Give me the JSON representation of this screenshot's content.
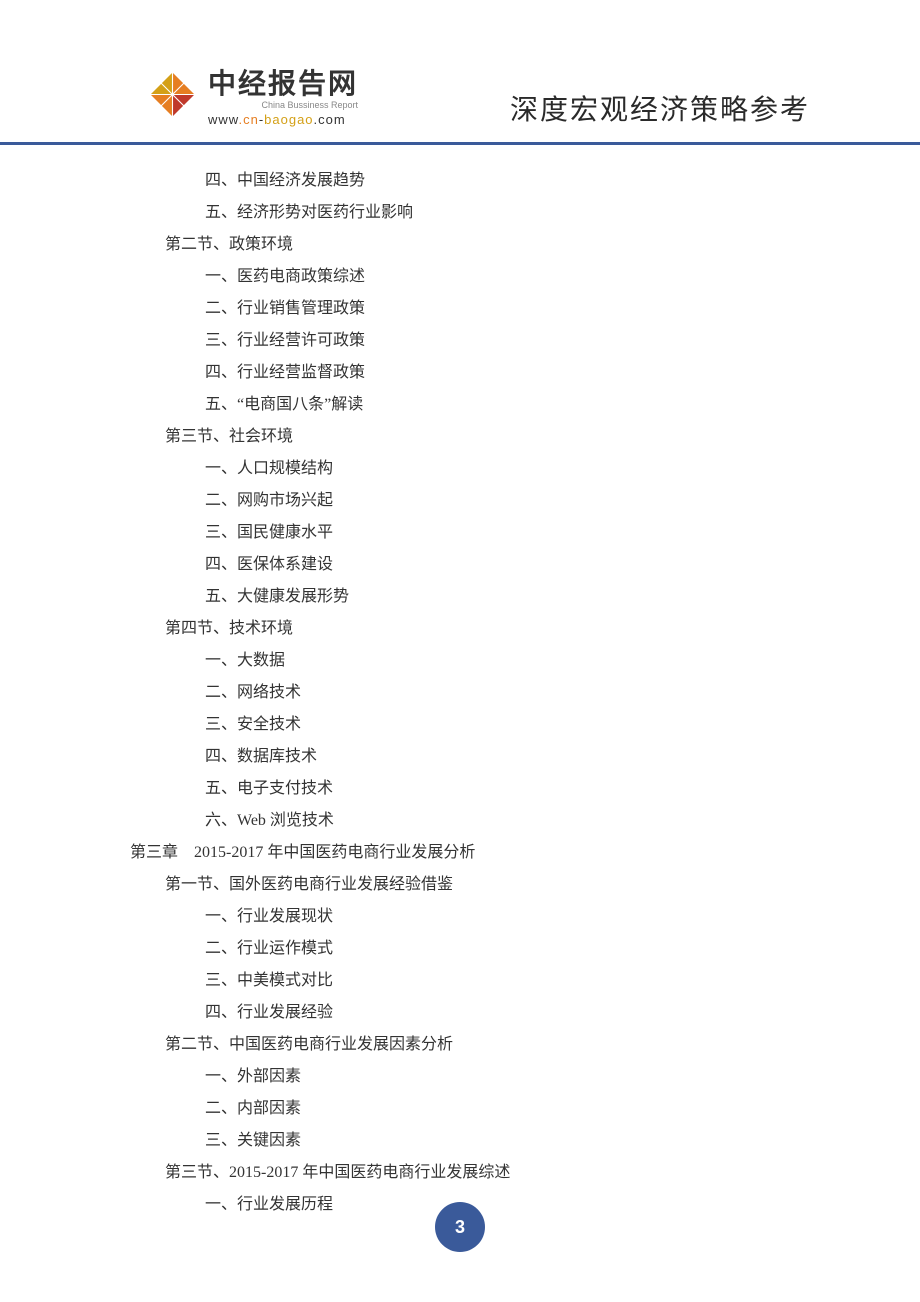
{
  "header": {
    "logo_title": "中经报告网",
    "logo_subtitle": "China Bussiness Report",
    "logo_url_www": "www",
    "logo_url_cn": "cn",
    "logo_url_baogao": "baogao",
    "logo_url_com": "com",
    "slogan": "深度宏观经济策略参考"
  },
  "toc": [
    {
      "level": 3,
      "text": "四、中国经济发展趋势"
    },
    {
      "level": 3,
      "text": "五、经济形势对医药行业影响"
    },
    {
      "level": 2,
      "text": "第二节、政策环境"
    },
    {
      "level": 3,
      "text": "一、医药电商政策综述"
    },
    {
      "level": 3,
      "text": "二、行业销售管理政策"
    },
    {
      "level": 3,
      "text": "三、行业经营许可政策"
    },
    {
      "level": 3,
      "text": "四、行业经营监督政策"
    },
    {
      "level": 3,
      "text": "五、“电商国八条”解读"
    },
    {
      "level": 2,
      "text": "第三节、社会环境"
    },
    {
      "level": 3,
      "text": "一、人口规模结构"
    },
    {
      "level": 3,
      "text": "二、网购市场兴起"
    },
    {
      "level": 3,
      "text": "三、国民健康水平"
    },
    {
      "level": 3,
      "text": "四、医保体系建设"
    },
    {
      "level": 3,
      "text": "五、大健康发展形势"
    },
    {
      "level": 2,
      "text": "第四节、技术环境"
    },
    {
      "level": 3,
      "text": "一、大数据"
    },
    {
      "level": 3,
      "text": "二、网络技术"
    },
    {
      "level": 3,
      "text": "三、安全技术"
    },
    {
      "level": 3,
      "text": "四、数据库技术"
    },
    {
      "level": 3,
      "text": "五、电子支付技术"
    },
    {
      "level": 3,
      "text": "六、Web 浏览技术"
    },
    {
      "level": 1,
      "text": "第三章　2015-2017 年中国医药电商行业发展分析"
    },
    {
      "level": 2,
      "text": "第一节、国外医药电商行业发展经验借鉴"
    },
    {
      "level": 3,
      "text": "一、行业发展现状"
    },
    {
      "level": 3,
      "text": "二、行业运作模式"
    },
    {
      "level": 3,
      "text": "三、中美模式对比"
    },
    {
      "level": 3,
      "text": "四、行业发展经验"
    },
    {
      "level": 2,
      "text": "第二节、中国医药电商行业发展因素分析"
    },
    {
      "level": 3,
      "text": "一、外部因素"
    },
    {
      "level": 3,
      "text": "二、内部因素"
    },
    {
      "level": 3,
      "text": "三、关键因素"
    },
    {
      "level": 2,
      "text": "第三节、2015-2017 年中国医药电商行业发展综述"
    },
    {
      "level": 3,
      "text": "一、行业发展历程"
    }
  ],
  "page_number": "3"
}
